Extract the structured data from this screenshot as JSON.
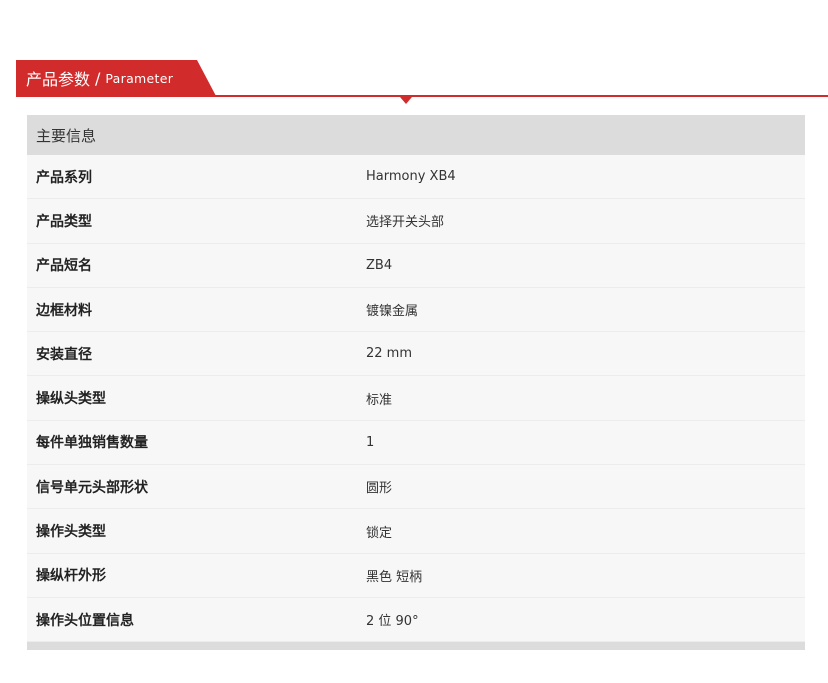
{
  "header": {
    "title": "产品参数",
    "separator": "/",
    "subtitle": "Parameter"
  },
  "panel": {
    "heading": "主要信息",
    "rows": [
      {
        "label": "产品系列",
        "value": "Harmony XB4"
      },
      {
        "label": "产品类型",
        "value": "选择开关头部"
      },
      {
        "label": "产品短名",
        "value": "ZB4"
      },
      {
        "label": "边框材料",
        "value": "镀镍金属"
      },
      {
        "label": "安装直径",
        "value": "22 mm"
      },
      {
        "label": "操纵头类型",
        "value": "标准"
      },
      {
        "label": "每件单独销售数量",
        "value": "1"
      },
      {
        "label": "信号单元头部形状",
        "value": "圆形"
      },
      {
        "label": "操作头类型",
        "value": "锁定"
      },
      {
        "label": "操纵杆外形",
        "value": "黑色 短柄"
      },
      {
        "label": "操作头位置信息",
        "value": "2 位 90°"
      }
    ]
  },
  "colors": {
    "accent": "#d22b2b",
    "panel_head_bg": "#dcdcdc",
    "row_bg": "#f7f7f7"
  }
}
